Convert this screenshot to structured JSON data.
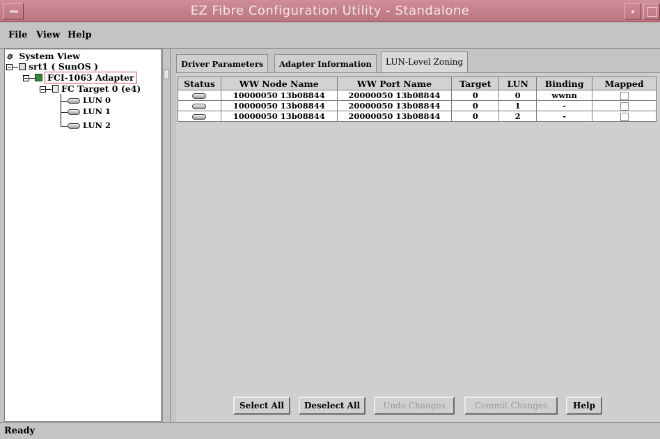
{
  "window": {
    "title": "EZ Fibre Configuration Utility - Standalone"
  },
  "menu": [
    {
      "label": "File"
    },
    {
      "label": "View"
    },
    {
      "label": "Help"
    }
  ],
  "tree": {
    "root": "System View",
    "host": "srt1 ( SunOS )",
    "adapter": "FCI-1063 Adapter",
    "target": "FC Target 0 (e4)",
    "luns": [
      "LUN 0",
      "LUN 1",
      "LUN 2"
    ]
  },
  "tabs": [
    {
      "label": "Driver Parameters"
    },
    {
      "label": "Adapter Information"
    },
    {
      "label": "LUN-Level Zoning",
      "active": true
    }
  ],
  "table": {
    "headers": [
      "Status",
      "WW Node Name",
      "WW Port Name",
      "Target",
      "LUN",
      "Binding",
      "Mapped"
    ],
    "rows": [
      {
        "node": "10000050 13b08844",
        "port": "20000050 13b08844",
        "target": "0",
        "lun": "0",
        "binding": "wwnn",
        "mapped": false
      },
      {
        "node": "10000050 13b08844",
        "port": "20000050 13b08844",
        "target": "0",
        "lun": "1",
        "binding": "-",
        "mapped": false
      },
      {
        "node": "10000050 13b08844",
        "port": "20000050 13b08844",
        "target": "0",
        "lun": "2",
        "binding": "-",
        "mapped": false
      }
    ]
  },
  "buttons": {
    "select_all": "Select All",
    "deselect_all": "Deselect All",
    "undo": "Undo Changes",
    "commit": "Commit Changes",
    "help": "Help"
  },
  "status": {
    "text": "Ready"
  }
}
